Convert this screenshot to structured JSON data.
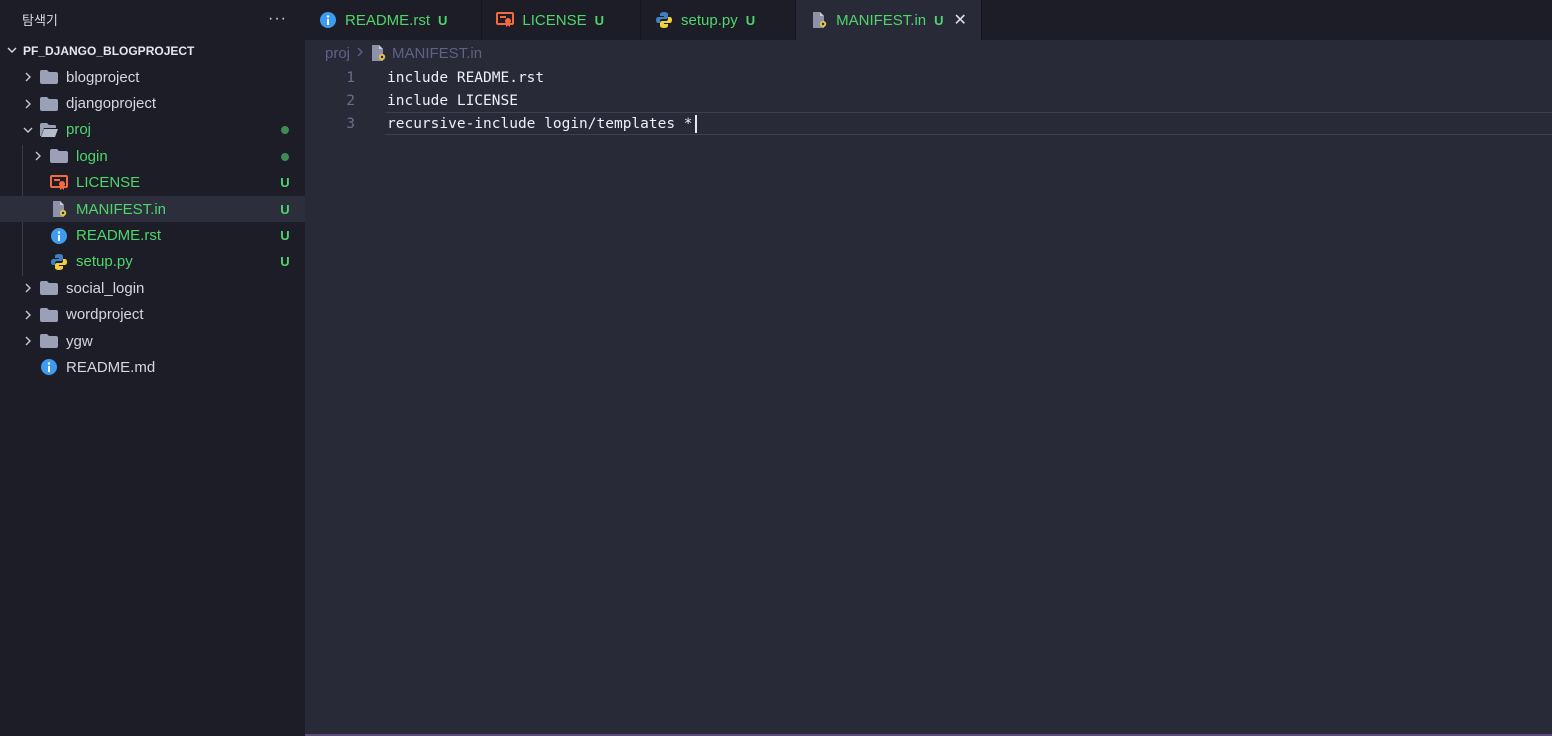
{
  "sidebar": {
    "title": "탐색기",
    "more": "···",
    "section": "PF_DJANGO_BLOGPROJECT",
    "items": [
      {
        "label": "blogproject"
      },
      {
        "label": "djangoproject"
      },
      {
        "label": "proj"
      },
      {
        "label": "login"
      },
      {
        "label": "LICENSE",
        "deco": "U"
      },
      {
        "label": "MANIFEST.in",
        "deco": "U"
      },
      {
        "label": "README.rst",
        "deco": "U"
      },
      {
        "label": "setup.py",
        "deco": "U"
      },
      {
        "label": "social_login"
      },
      {
        "label": "wordproject"
      },
      {
        "label": "ygw"
      },
      {
        "label": "README.md"
      }
    ]
  },
  "tabs": [
    {
      "label": "README.rst",
      "status": "U"
    },
    {
      "label": "LICENSE",
      "status": "U"
    },
    {
      "label": "setup.py",
      "status": "U"
    },
    {
      "label": "MANIFEST.in",
      "status": "U",
      "close": "✕"
    }
  ],
  "breadcrumb": {
    "folder": "proj",
    "file": "MANIFEST.in"
  },
  "code": {
    "lines": [
      {
        "n": "1",
        "text": "include README.rst"
      },
      {
        "n": "2",
        "text": "include LICENSE"
      },
      {
        "n": "3",
        "text": "recursive-include login/templates *"
      }
    ]
  },
  "colors": {
    "untracked": "#4fd66b",
    "background": "#282a38",
    "sidebar": "#1c1d26"
  }
}
